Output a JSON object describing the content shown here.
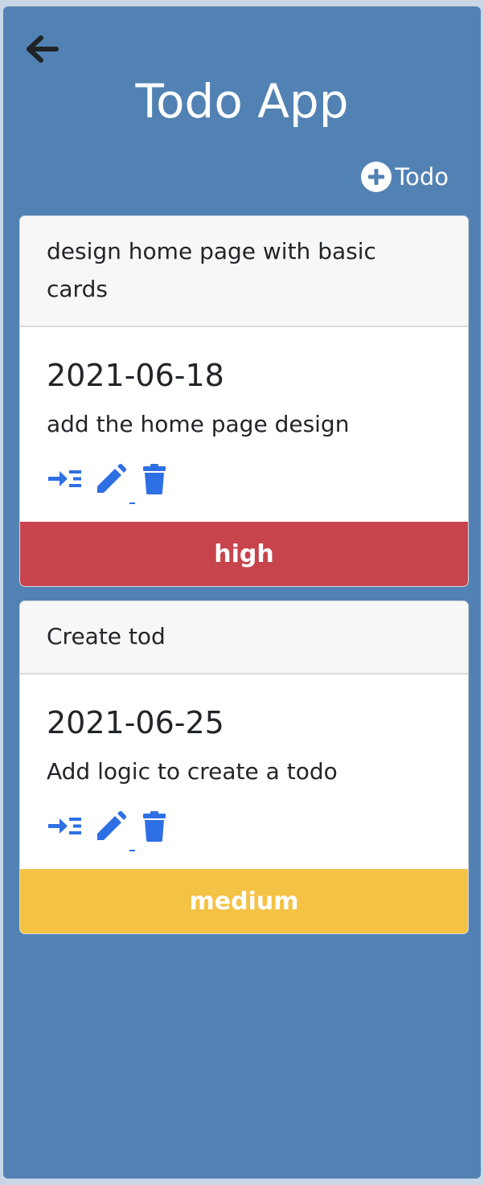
{
  "app": {
    "title": "Todo App",
    "add_button_label": "Todo"
  },
  "colors": {
    "background": "#5282b3",
    "icon_blue": "#2f6fe4",
    "priority_high": "#c8444d",
    "priority_medium": "#f4c244"
  },
  "icons": {
    "back": "arrow-left-icon",
    "add": "plus-circle-icon",
    "view": "indent-icon",
    "edit": "pencil-icon",
    "delete": "trash-icon"
  },
  "todos": [
    {
      "title": "design home page with basic cards",
      "date": "2021-06-18",
      "description": "add the home page design",
      "priority": "high"
    },
    {
      "title": "Create tod",
      "date": "2021-06-25",
      "description": "Add logic to create a todo",
      "priority": "medium"
    }
  ]
}
